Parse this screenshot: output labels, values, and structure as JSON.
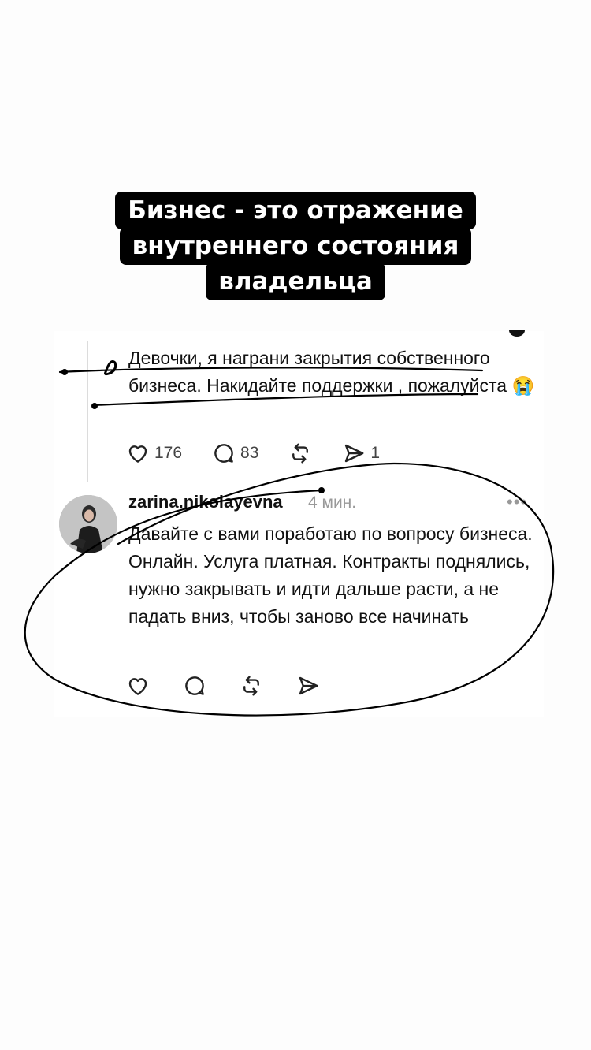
{
  "caption": {
    "lines": [
      "Бизнес - это отражение",
      "внутреннего состояния",
      "владельца"
    ]
  },
  "original_post": {
    "text": "Девочки, я награни закрытия собственного бизнеса. Накидайте поддержки , пожалуйста 😭",
    "likes": "176",
    "comments": "83",
    "shares": "1"
  },
  "reply": {
    "username": "zarina.nikolayevna",
    "time": "4 мин.",
    "text": "Давайте с вами поработаю по вопросу бизнеса. Онлайн. Услуга платная. Контракты поднялись, нужно закрывать и идти дальше расти, а не падать вниз, чтобы заново все начинать"
  },
  "icons": {
    "like": "heart-icon",
    "comment": "comment-icon",
    "repost": "repost-icon",
    "share": "send-icon",
    "more": "more-icon"
  },
  "colors": {
    "ink": "#000000",
    "caption_bg": "#000000",
    "caption_text": "#ffffff",
    "meta": "#999999"
  }
}
